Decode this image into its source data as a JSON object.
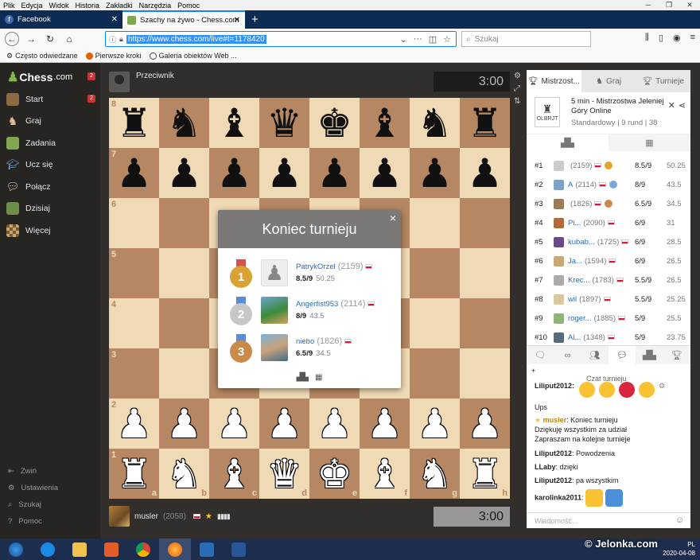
{
  "browser": {
    "menu": [
      "Plik",
      "Edycja",
      "Widok",
      "Historia",
      "Zakładki",
      "Narzędzia",
      "Pomoc"
    ],
    "tabs": [
      {
        "title": "Facebook"
      },
      {
        "title": "Szachy na żywo - Chess.com"
      }
    ],
    "url": "https://www.chess.com/live#t=1178420",
    "search_placeholder": "Szukaj",
    "bookmarks": [
      "Często odwiedzane",
      "Pierwsze kroki",
      "Galeria obiektów Web ..."
    ]
  },
  "site": {
    "logo_text": "Chess",
    "logo_suffix": ".com",
    "badge": "2",
    "nav": [
      "Start",
      "Graj",
      "Zadania",
      "Ucz się",
      "Połącz",
      "Dzisiaj",
      "Więcej"
    ],
    "start_badge": "2",
    "bottom_nav": [
      "Zwiń",
      "Ustawienia",
      "Szukaj",
      "Pomoc"
    ]
  },
  "game": {
    "top_player": "Przeciwnik",
    "top_clock": "3:00",
    "bottom_player": "musler",
    "bottom_rating": "(2058)",
    "bottom_clock": "3:00",
    "ranks": [
      "8",
      "7",
      "6",
      "5",
      "4",
      "3",
      "2",
      "1"
    ],
    "files": [
      "a",
      "b",
      "c",
      "d",
      "e",
      "f",
      "g",
      "h"
    ]
  },
  "modal": {
    "title": "Koniec turnieju",
    "close": "×",
    "places": [
      {
        "medal": "1",
        "name": "PatrykOrzel",
        "rating": "(2159)",
        "score": "8.5/9",
        "buchholz": "50.25",
        "medal_color": "#d9a233"
      },
      {
        "medal": "2",
        "name": "Angerfist953",
        "rating": "(2114)",
        "score": "8/9",
        "buchholz": "43.5",
        "medal_color": "#b5b5b5"
      },
      {
        "medal": "3",
        "name": "niebo",
        "rating": "(1826)",
        "score": "6.5/9",
        "buchholz": "34.5",
        "medal_color": "#c98a4a"
      }
    ]
  },
  "panel": {
    "tabs": [
      "Mistrzost...",
      "Graj",
      "Turnieje"
    ],
    "tournament_name": "5 min - Mistrzostwa Jeleniej Góry Online",
    "tournament_meta": "Standardowy | 9 rund | 38",
    "logo_text": "OLBRJT",
    "standings": [
      {
        "rank": "#1",
        "name": "",
        "rating": "(2159)",
        "score": "8.5/9",
        "bc": "50.25"
      },
      {
        "rank": "#2",
        "name": "A",
        "rating": "(2114)",
        "score": "8/9",
        "bc": "43.5"
      },
      {
        "rank": "#3",
        "name": "",
        "rating": "(1826)",
        "score": "6.5/9",
        "bc": "34.5"
      },
      {
        "rank": "#4",
        "name": "Pi...",
        "rating": "(2090)",
        "score": "6/9",
        "bc": "31"
      },
      {
        "rank": "#5",
        "name": "kubab...",
        "rating": "(1725)",
        "score": "6/9",
        "bc": "28.5"
      },
      {
        "rank": "#6",
        "name": "Ja...",
        "rating": "(1594)",
        "score": "6/9",
        "bc": "26.5"
      },
      {
        "rank": "#7",
        "name": "Krec...",
        "rating": "(1783)",
        "score": "5.5/9",
        "bc": "26.5"
      },
      {
        "rank": "#8",
        "name": "wil",
        "rating": "(1897)",
        "score": "5.5/9",
        "bc": "25.25"
      },
      {
        "rank": "#9",
        "name": "roger...",
        "rating": "(1885)",
        "score": "5/9",
        "bc": "25.5"
      },
      {
        "rank": "#10",
        "name": "Al...",
        "rating": "(1348)",
        "score": "5/9",
        "bc": "23.75"
      }
    ],
    "chat_header": "Czat turnieju",
    "chat_top_user": "Liliput2012:",
    "chat": [
      {
        "user": "",
        "text": "Ups"
      },
      {
        "user": "musler",
        "text": ": Koniec turnieju"
      },
      {
        "user": "",
        "text": "Dziękuję wszystkim za udział"
      },
      {
        "user": "",
        "text": "Zapraszam na kolejne turnieje"
      },
      {
        "user": "Liliput2012",
        "text": ": Powodzenia"
      },
      {
        "user": "LLaby",
        "text": ": dzięki"
      },
      {
        "user": "Liliput2012",
        "text": ": pa wszystkim"
      },
      {
        "user": "karolinka2011",
        "text": ":"
      }
    ],
    "chat_placeholder": "Wiadomość..."
  },
  "taskbar": {
    "tray_letters": "PL",
    "date": "2020-04-08"
  },
  "watermark": "© Jelonka.com"
}
